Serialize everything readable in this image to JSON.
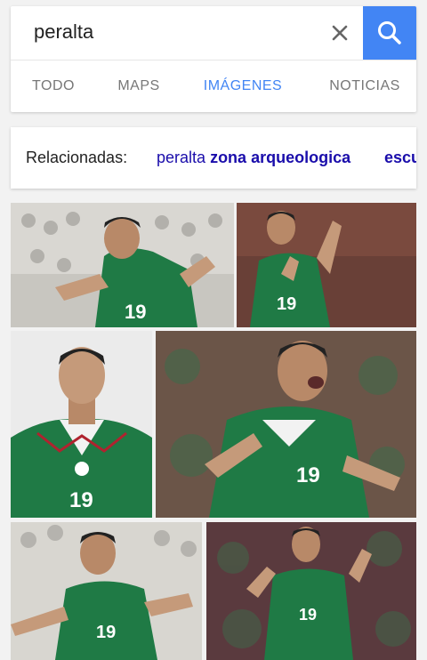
{
  "search": {
    "query": "peralta"
  },
  "tabs": [
    {
      "label": "TODO",
      "active": false
    },
    {
      "label": "MAPS",
      "active": false
    },
    {
      "label": "IMÁGENES",
      "active": true
    },
    {
      "label": "NOTICIAS",
      "active": false
    }
  ],
  "related": {
    "label": "Relacionadas:",
    "chips": [
      {
        "plain": "peralta",
        "bold": "zona arqueologica"
      },
      {
        "plain": "",
        "bold": "escu"
      }
    ]
  },
  "colors": {
    "accent": "#4285f4",
    "link": "#1a0dab",
    "jersey_green": "#1f7a45"
  },
  "icons": {
    "clear": "close-icon",
    "search": "search-icon"
  },
  "jersey_number": "19"
}
